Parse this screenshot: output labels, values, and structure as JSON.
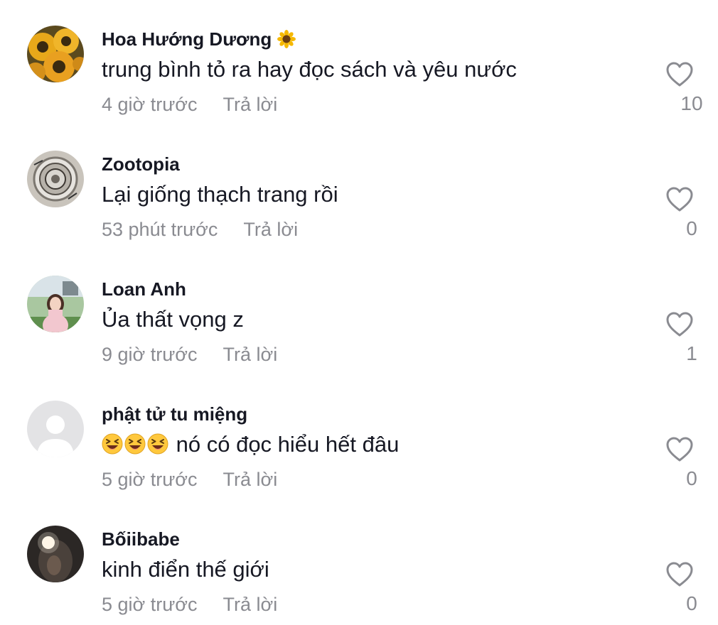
{
  "comments": [
    {
      "username": "Hoa Hướng Dương",
      "username_emoji": "sunflower",
      "text": "trung bình tỏ ra hay đọc sách và yêu nước",
      "time": "4 giờ trước",
      "reply_label": "Trả lời",
      "likes": "10",
      "avatar": "sunflowers-photo"
    },
    {
      "username": "Zootopia",
      "text": "Lại giống thạch trang rồi",
      "time": "53 phút trước",
      "reply_label": "Trả lời",
      "likes": "0",
      "avatar": "metal-disc-photo"
    },
    {
      "username": "Loan Anh",
      "text": "Ủa thất vọng z",
      "time": "9 giờ trước",
      "reply_label": "Trả lời",
      "likes": "1",
      "avatar": "girl-pink-dress-photo"
    },
    {
      "username": "phật tử tu miệng",
      "text_emojis": [
        "laughing-face",
        "laughing-face",
        "laughing-face"
      ],
      "text": "nó có đọc hiểu hết đâu",
      "time": "5 giờ trước",
      "reply_label": "Trả lời",
      "likes": "0",
      "avatar": "default-user-icon"
    },
    {
      "username": "Bốiibabe",
      "text": "kinh điển thế giới",
      "time": "5 giờ trước",
      "reply_label": "Trả lời",
      "likes": "0",
      "avatar": "dark-selfie-photo"
    }
  ],
  "colors": {
    "primary_text": "#161823",
    "secondary_text": "#8a8b91",
    "background": "#ffffff"
  }
}
